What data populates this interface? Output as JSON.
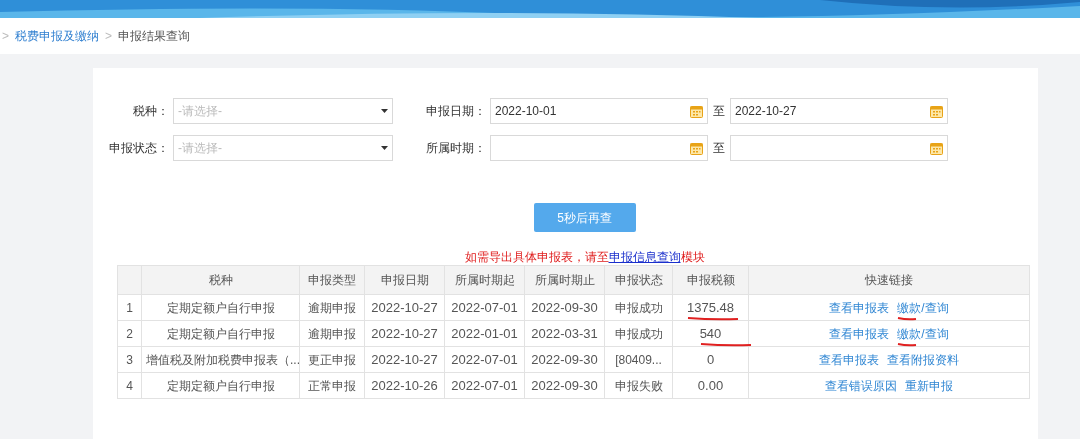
{
  "breadcrumb": [
    {
      "kind": "separator",
      "text": ">"
    },
    {
      "kind": "link",
      "text": "税费申报及缴纳"
    },
    {
      "kind": "separator",
      "text": ">"
    },
    {
      "kind": "current",
      "text": "申报结果查询"
    }
  ],
  "filters": [
    {
      "kind": "select",
      "label": "税种：",
      "placeholder": "-请选择-"
    },
    {
      "kind": "range",
      "label": "申报日期：",
      "from": "2022-10-01",
      "to_label": "至",
      "to": "2022-10-27"
    },
    {
      "kind": "select",
      "label": "申报状态：",
      "placeholder": "-请选择-"
    },
    {
      "kind": "range",
      "label": "所属时期：",
      "to_label": "至"
    }
  ],
  "query_button": "5秒后再查",
  "notice": {
    "before": "如需导出具体申报表，请至",
    "link": "申报信息查询",
    "after": "模块"
  },
  "table": {
    "columns": [
      "",
      "税种",
      "申报类型",
      "申报日期",
      "所属时期起",
      "所属时期止",
      "申报状态",
      "申报税额",
      "快速链接"
    ],
    "rows": [
      {
        "no": "1",
        "tax": "定期定额户自行申报",
        "type": "逾期申报",
        "date": "2022-10-27",
        "from": "2022-07-01",
        "to": "2022-09-30",
        "status": "申报成功",
        "amount": "1375.48",
        "amount_marked": true,
        "links": [
          {
            "text": "查看申报表",
            "marked": false
          },
          {
            "text": "缴款/查询",
            "marked": true
          }
        ]
      },
      {
        "no": "2",
        "tax": "定期定额户自行申报",
        "type": "逾期申报",
        "date": "2022-10-27",
        "from": "2022-01-01",
        "to": "2022-03-31",
        "status": "申报成功",
        "amount": "540",
        "amount_marked": true,
        "links": [
          {
            "text": "查看申报表",
            "marked": false
          },
          {
            "text": "缴款/查询",
            "marked": true
          }
        ]
      },
      {
        "no": "3",
        "tax": "增值税及附加税费申报表（...",
        "type": "更正申报",
        "date": "2022-10-27",
        "from": "2022-07-01",
        "to": "2022-09-30",
        "status": "[80409...",
        "amount": "0",
        "amount_marked": false,
        "links": [
          {
            "text": "查看申报表",
            "marked": false
          },
          {
            "text": "查看附报资料",
            "marked": false
          }
        ]
      },
      {
        "no": "4",
        "tax": "定期定额户自行申报",
        "type": "正常申报",
        "date": "2022-10-26",
        "from": "2022-07-01",
        "to": "2022-09-30",
        "status": "申报失败",
        "amount": "0.00",
        "amount_marked": false,
        "links": [
          {
            "text": "查看错误原因",
            "marked": false
          },
          {
            "text": "重新申报",
            "marked": false
          }
        ]
      }
    ]
  }
}
